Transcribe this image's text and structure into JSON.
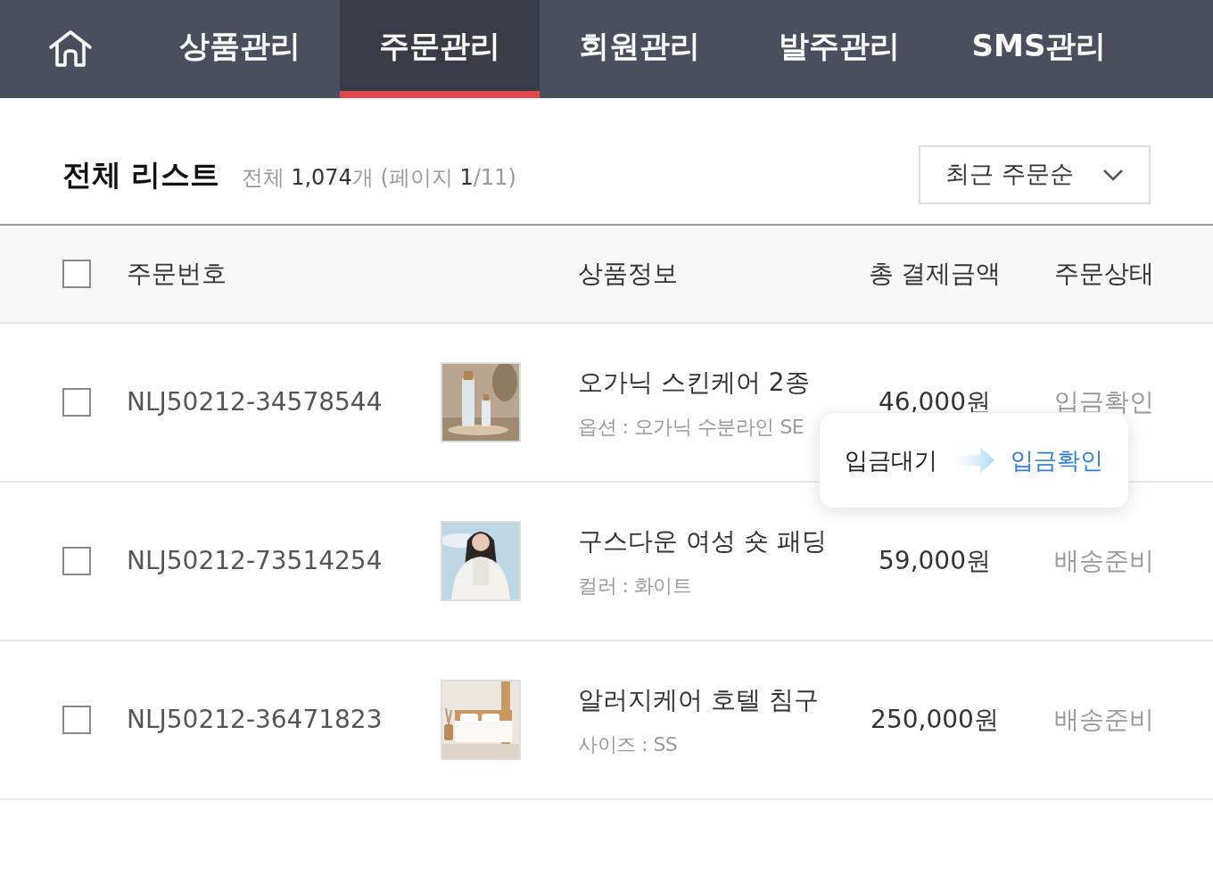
{
  "nav": {
    "tabs": [
      {
        "label": "상품관리",
        "selected": false
      },
      {
        "label": "주문관리",
        "selected": true
      },
      {
        "label": "회원관리",
        "selected": false
      },
      {
        "label": "발주관리",
        "selected": false
      },
      {
        "label": "SMS관리",
        "selected": false
      }
    ]
  },
  "list": {
    "title": "전체 리스트",
    "summary": "전체 **1,074**개 (페이지 **1**/11)",
    "sort": "최근 주문순"
  },
  "table": {
    "select_all": {
      "checked": false
    },
    "columns": [
      "주문번호",
      "상품정보",
      "총 결제금액",
      "주문상태"
    ],
    "rows": [
      {
        "checked": false,
        "order_no": "NLJ50212-34578544",
        "name": "오가닉 스킨케어 2종",
        "option": "옵션 : 오가닉 수분라인 SE",
        "price": "46,000원",
        "status": "입금확인"
      },
      {
        "checked": false,
        "order_no": "NLJ50212-73514254",
        "name": "구스다운 여성 숏 패딩",
        "option": "컬러 : 화이트",
        "price": "59,000원",
        "status": "배송준비"
      },
      {
        "checked": false,
        "order_no": "NLJ50212-36471823",
        "name": "알러지케어 호텔 침구",
        "option": "사이즈 : SS",
        "price": "250,000원",
        "status": "배송준비"
      }
    ]
  },
  "status_popup": {
    "from": "입금대기",
    "to": "입금확인"
  }
}
